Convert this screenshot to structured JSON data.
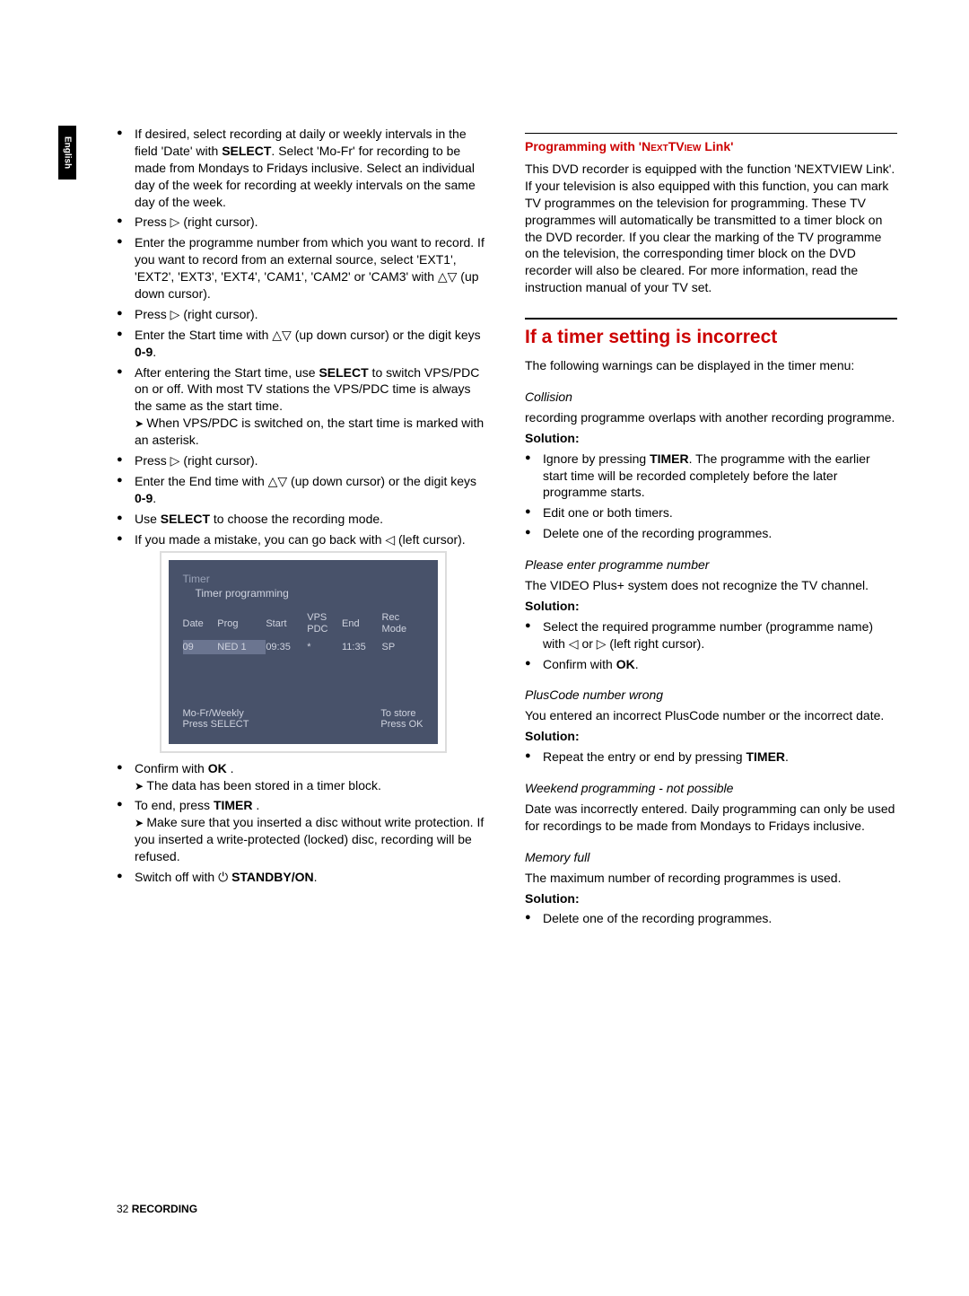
{
  "side_tab": "English",
  "left": {
    "b1_part1": "If desired, select recording at daily or weekly intervals in the field '",
    "b1_date": "Date",
    "b1_part2": "' with ",
    "b1_select": "SELECT",
    "b1_part3": ". Select '",
    "b1_mofr": "Mo-Fr",
    "b1_part4": "' for recording to be made from Mondays to Fridays inclusive. Select an individual day of the week for recording at weekly intervals on the same day of the week.",
    "b2": "Press ▷ (right cursor).",
    "b3_part1": "Enter the programme number from which you want to record. If you want to record from an external source, select '",
    "b3_ext1": "EXT1",
    "b3_c": "', '",
    "b3_ext2": "EXT2",
    "b3_ext3": "EXT3",
    "b3_ext4": "EXT4",
    "b3_cam1": "CAM1",
    "b3_cam2": "CAM2",
    "b3_or": "' or '",
    "b3_cam3": "CAM3",
    "b3_part2": "' with △▽ (up down cursor).",
    "b4": "Press ▷ (right cursor).",
    "b5_part1": "Enter the Start time with △▽ (up down cursor) or the digit keys ",
    "b5_keys": "0-9",
    "b5_part2": ".",
    "b6_part1": "After entering the Start time, use ",
    "b6_select": "SELECT",
    "b6_part2": " to switch VPS/PDC on or off. With most TV stations the VPS/PDC time is always the same as the start time.",
    "b6_arrow": "When VPS/PDC is switched on, the start time is marked with an asterisk.",
    "b7": "Press ▷ (right cursor).",
    "b8_part1": "Enter the End time with △▽ (up down cursor) or the digit keys ",
    "b8_keys": "0-9",
    "b8_part2": ".",
    "b9_part1": "Use ",
    "b9_select": "SELECT",
    "b9_part2": " to choose the recording mode.",
    "b10": "If you made a mistake, you can go back with ◁ (left cursor).",
    "timer": {
      "title": "Timer",
      "subtitle": "Timer programming",
      "headers": {
        "date": "Date",
        "prog": "Prog",
        "start": "Start",
        "vps": "VPS\nPDC",
        "end": "End",
        "rec": "Rec\nMode"
      },
      "row": {
        "date": "09",
        "prog": "NED 1",
        "start": "09:35",
        "vps": "*",
        "end": "11:35",
        "rec": "SP"
      },
      "footer_left1": "Mo-Fr/Weekly",
      "footer_left2": "Press SELECT",
      "footer_right1": "To store",
      "footer_right2": "Press OK"
    },
    "c1_part1": "Confirm with ",
    "c1_ok": "OK",
    "c1_part2": " .",
    "c1_arrow": "The data has been stored in a timer block.",
    "c2_part1": "To end, press ",
    "c2_timer": "TIMER",
    "c2_part2": " .",
    "c2_arrow": "Make sure that you inserted a disc without write protection. If you inserted a write-protected (locked) disc, recording will be refused.",
    "c3_part1": "Switch off with ⏻ ",
    "c3_standby": "STANDBY/ON",
    "c3_part2": "."
  },
  "right": {
    "h_prog": "Programming with 'NEXTVIEW Link'",
    "p_prog": "This DVD recorder is equipped with the function 'NEXTVIEW Link'. If your television is also equipped with this function, you can mark TV programmes on the television for programming. These TV programmes will automatically be transmitted to a timer block on the DVD recorder. If you clear the marking of the TV programme on the television, the corresponding timer block on the DVD recorder will also be cleared. For more information, read the instruction manual of your TV set.",
    "h_timer": "If a timer setting is incorrect",
    "p_timer_intro": "The following warnings can be displayed in the timer menu:",
    "h_collision": "Collision",
    "p_collision": "recording programme overlaps with another recording programme.",
    "solution": "Solution:",
    "col_b1_part1": "Ignore by pressing ",
    "col_b1_timer": "TIMER",
    "col_b1_part2": ". The programme with the earlier start time will be recorded completely before the later programme starts.",
    "col_b2": "Edit one or both timers.",
    "col_b3": "Delete one of the recording programmes.",
    "h_please": "Please enter programme number",
    "p_please": "The VIDEO Plus+ system does not recognize the TV channel.",
    "pl_b1": "Select the required programme number (programme name) with ◁ or ▷  (left right cursor).",
    "pl_b2_part1": "Confirm with ",
    "pl_b2_ok": "OK",
    "pl_b2_part2": ".",
    "h_plus": "PlusCode number wrong",
    "p_plus": "You entered an incorrect PlusCode number or the incorrect date.",
    "plus_b1_part1": "Repeat the entry or end by pressing ",
    "plus_b1_timer": "TIMER",
    "plus_b1_part2": ".",
    "h_weekend": "Weekend programming - not possible",
    "p_weekend": "Date was incorrectly entered. Daily programming can only be used for recordings to be made from Mondays to Fridays inclusive.",
    "h_memory": "Memory full",
    "p_memory": "The maximum number of recording programmes is used.",
    "mem_b1": "Delete one of the recording programmes."
  },
  "footer": {
    "page": "32",
    "section": "RECORDING"
  }
}
